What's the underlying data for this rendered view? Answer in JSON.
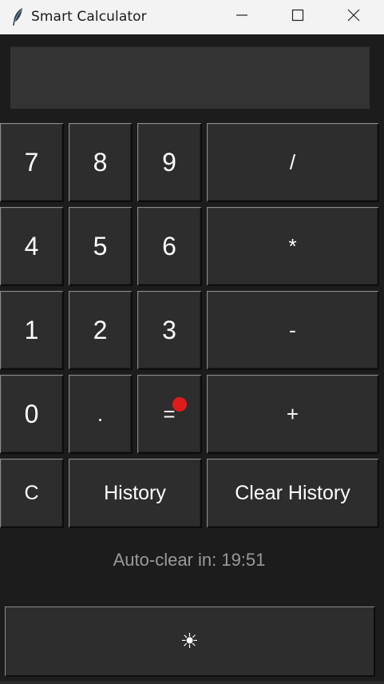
{
  "window": {
    "title": "Smart Calculator",
    "app_icon": "feather-icon",
    "controls": {
      "minimize_icon": "minimize-icon",
      "maximize_icon": "maximize-icon",
      "close_icon": "close-icon"
    }
  },
  "display": {
    "value": ""
  },
  "keypad": {
    "k7": "7",
    "k8": "8",
    "k9": "9",
    "div": "/",
    "k4": "4",
    "k5": "5",
    "k6": "6",
    "mul": "*",
    "k1": "1",
    "k2": "2",
    "k3": "3",
    "sub": "-",
    "k0": "0",
    "dot": ".",
    "eq": "=",
    "add": "+",
    "clear": "C",
    "history": "History",
    "clear_history": "Clear History"
  },
  "status": {
    "auto_clear": "Auto-clear in: 19:51",
    "indicator_color": "#e01b1b"
  },
  "theme_toggle": {
    "label": "☀",
    "icon": "sun-icon"
  },
  "colors": {
    "background": "#1c1c1c",
    "button": "#2d2d2d",
    "display": "#333333",
    "titlebar": "#f3f3f3",
    "muted_text": "#9a9a9a"
  }
}
